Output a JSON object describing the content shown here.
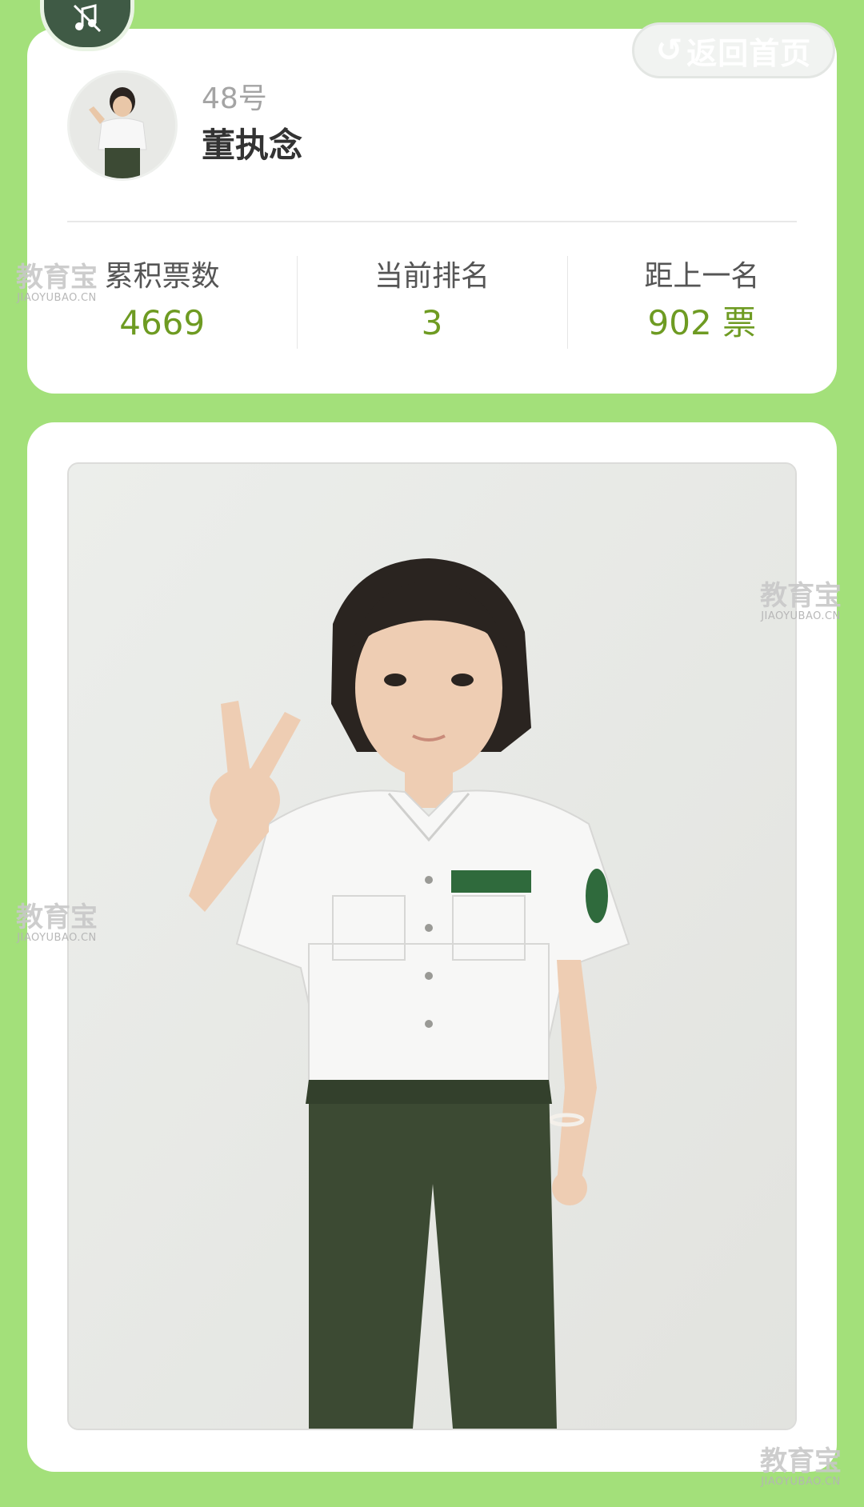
{
  "header": {
    "music_icon": "music-note-icon",
    "back_button_label": "返回首页",
    "back_icon": "return-arrow-icon"
  },
  "player": {
    "number": "48号",
    "name": "董执念"
  },
  "stats": [
    {
      "label": "累积票数",
      "value": "4669"
    },
    {
      "label": "当前排名",
      "value": "3"
    },
    {
      "label": "距上一名",
      "value": "902 票"
    }
  ],
  "watermark": {
    "main": "教育宝",
    "sub": "JIAOYUBAO.CN"
  },
  "colors": {
    "page_background": "#a3e07a",
    "card_background": "#ffffff",
    "accent_value": "#6e9b22",
    "label_text": "#555555",
    "name_text": "#333333",
    "number_text": "#a4a4a4"
  }
}
